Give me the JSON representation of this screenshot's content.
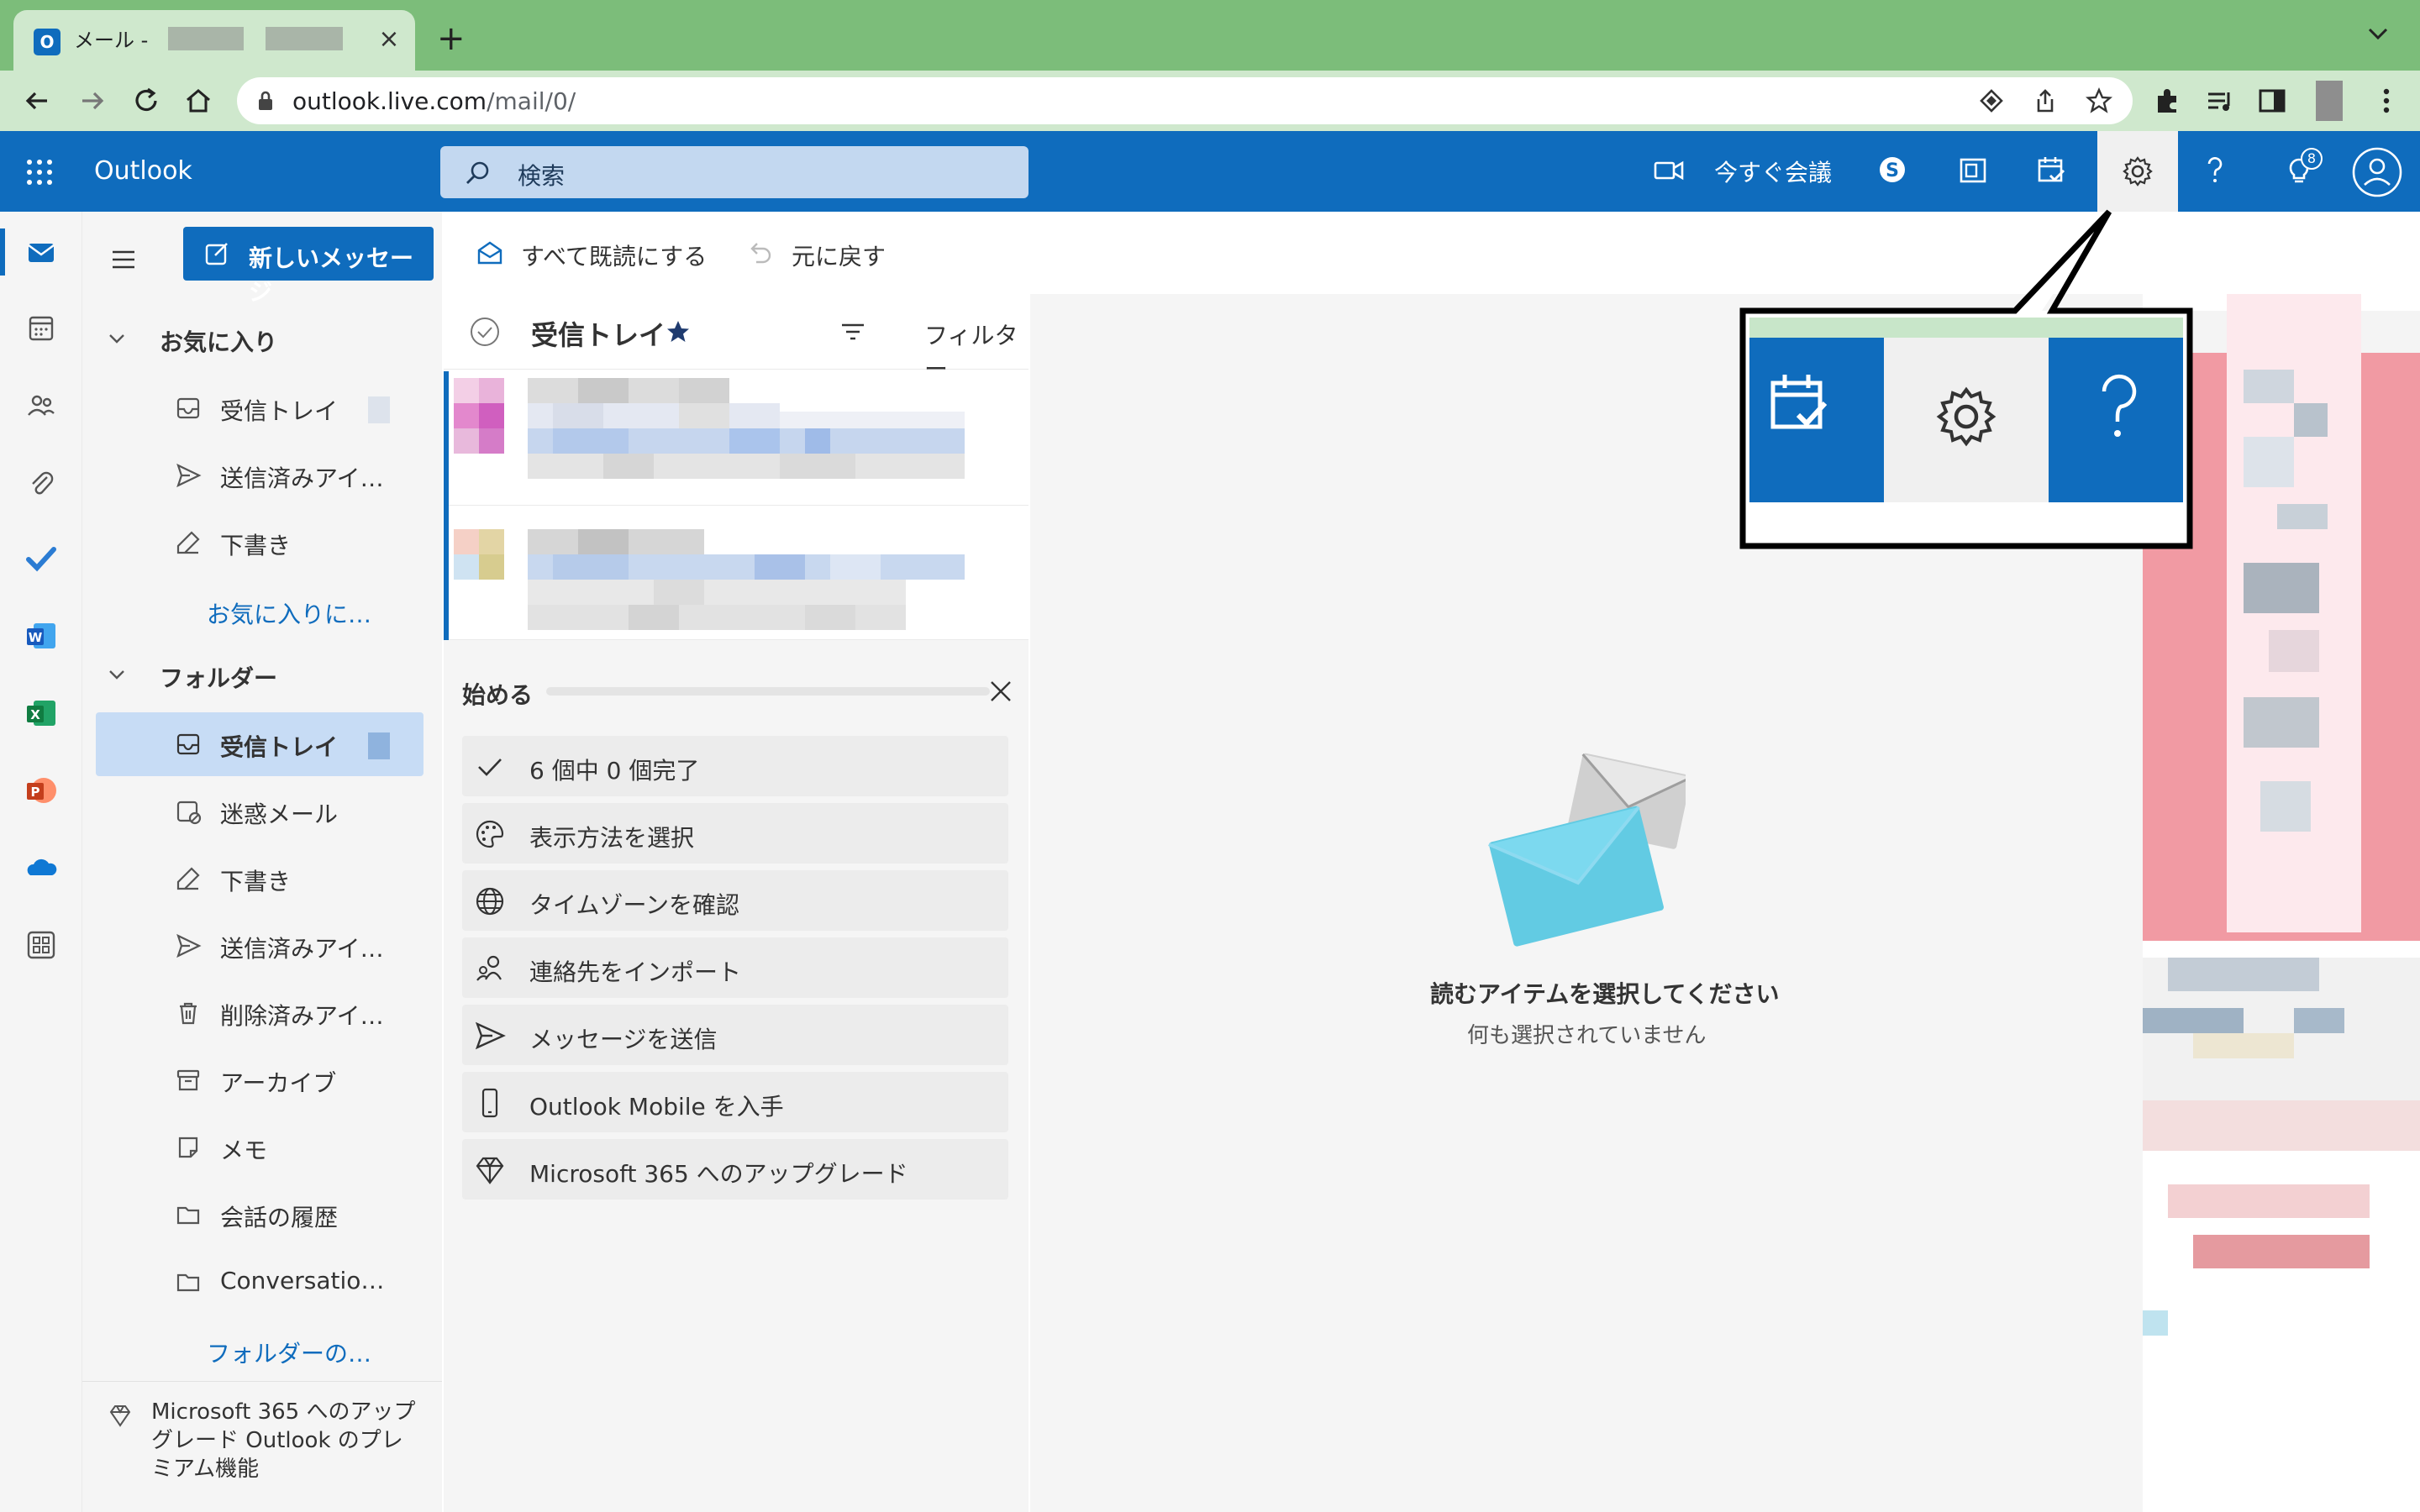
{
  "browser": {
    "tab_title": "メール -",
    "url_host": "outlook.live.com",
    "url_path": "/mail/0/",
    "new_tab": "+",
    "close_tab": "×"
  },
  "header": {
    "app_name": "Outlook",
    "search_placeholder": "検索",
    "meet_now": "今すぐ会議",
    "notification_count": "8"
  },
  "commands": {
    "new_message": "新しいメッセージ",
    "mark_all_read": "すべて既読にする",
    "undo": "元に戻す"
  },
  "favorites": {
    "header": "お気に入り",
    "items": [
      {
        "label": "受信トレイ",
        "icon": "inbox-icon"
      },
      {
        "label": "送信済みアイ…",
        "icon": "send-icon"
      },
      {
        "label": "下書き",
        "icon": "draft-icon"
      }
    ],
    "add_link": "お気に入りに…"
  },
  "folders": {
    "header": "フォルダー",
    "items": [
      {
        "label": "受信トレイ",
        "icon": "inbox-icon",
        "selected": true
      },
      {
        "label": "迷惑メール",
        "icon": "junk-icon"
      },
      {
        "label": "下書き",
        "icon": "draft-icon"
      },
      {
        "label": "送信済みアイ…",
        "icon": "send-icon"
      },
      {
        "label": "削除済みアイ…",
        "icon": "trash-icon"
      },
      {
        "label": "アーカイブ",
        "icon": "archive-icon"
      },
      {
        "label": "メモ",
        "icon": "note-icon"
      },
      {
        "label": "会話の履歴",
        "icon": "folder-icon"
      },
      {
        "label": "Conversatio…",
        "icon": "folder-icon"
      }
    ],
    "more_link": "フォルダーの…"
  },
  "upgrade_promo": "Microsoft 365 へのアップグレード Outlook のプレミアム機能",
  "message_list": {
    "title": "受信トレイ",
    "filter": "フィルター"
  },
  "getting_started": {
    "title": "始める",
    "progress": 0.0,
    "items": [
      {
        "label": "6 個中 0 個完了",
        "icon": "check-icon"
      },
      {
        "label": "表示方法を選択",
        "icon": "palette-icon"
      },
      {
        "label": "タイムゾーンを確認",
        "icon": "globe-icon"
      },
      {
        "label": "連絡先をインポート",
        "icon": "people-icon"
      },
      {
        "label": "メッセージを送信",
        "icon": "send-icon"
      },
      {
        "label": "Outlook Mobile を入手",
        "icon": "phone-icon"
      },
      {
        "label": "Microsoft 365 へのアップグレード",
        "icon": "diamond-icon"
      }
    ]
  },
  "reading_pane": {
    "heading": "読むアイテムを選択してください",
    "subtext": "何も選択されていません"
  },
  "colors": {
    "brand_blue": "#0f6cbd",
    "chrome_green": "#7cbd7a",
    "chrome_light_green": "#cfe8cd",
    "pane_gray": "#f5f5f5"
  }
}
